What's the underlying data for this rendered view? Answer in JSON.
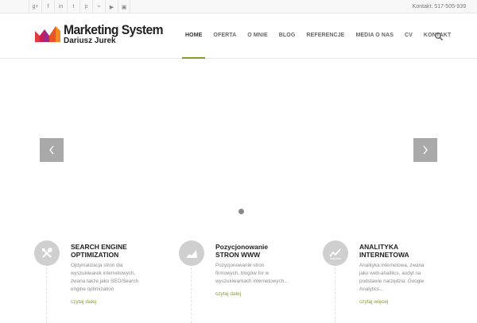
{
  "topbar": {
    "social_icons": [
      "google-plus-icon",
      "facebook-icon",
      "linkedin-icon",
      "twitter-icon",
      "pinterest-icon",
      "rss-icon",
      "youtube-icon",
      "instagram-icon"
    ],
    "social_glyphs": [
      "g+",
      "f",
      "in",
      "t",
      "p",
      "≈",
      "▶",
      "▣"
    ],
    "contact": "Kontakt: 517-505-939"
  },
  "header": {
    "logo_title": "Marketing System",
    "logo_subtitle": "Dariusz Jurek",
    "nav": [
      "HOME",
      "OFERTA",
      "O MNIE",
      "BLOG",
      "REFERENCJE",
      "MEDIA O NAS",
      "CV",
      "KONTAKT"
    ],
    "active_nav": "HOME"
  },
  "slider": {
    "prev_label": "‹",
    "next_label": "›"
  },
  "services": [
    {
      "icon": "tools-icon",
      "title_lines": [
        "SEARCH ENGINE",
        "OPTIMIZATION"
      ],
      "text_lines": [
        "Optymalizacja  stron dla",
        "wyszukiwarek internetowych,",
        "zwana także jako SEO/Search",
        "engine optimization"
      ],
      "link": "czytaj dalej"
    },
    {
      "icon": "chart-icon",
      "title_lines": [
        "Pozycjonowanie",
        "STRON WWW"
      ],
      "text_lines": [
        "Pozycjonowanie stron",
        "firmowych, blogów for  w",
        "wyszukiwarkach internetowych..."
      ],
      "link": "czytaj dalej"
    },
    {
      "icon": "trend-icon",
      "title_lines": [
        "ANALITYKA",
        "INTERNETOWA"
      ],
      "text_lines": [
        "Analityka internetowa, zwana",
        "jako web-analitics, audyt na",
        "podstawie narzędzia: Google",
        "Analytics..."
      ],
      "link": "czytaj więcej"
    }
  ],
  "colors": {
    "accent": "#8c9a2c",
    "arrow_bg": "#a9a9a9",
    "icon_circle": "#cfcfcf"
  }
}
